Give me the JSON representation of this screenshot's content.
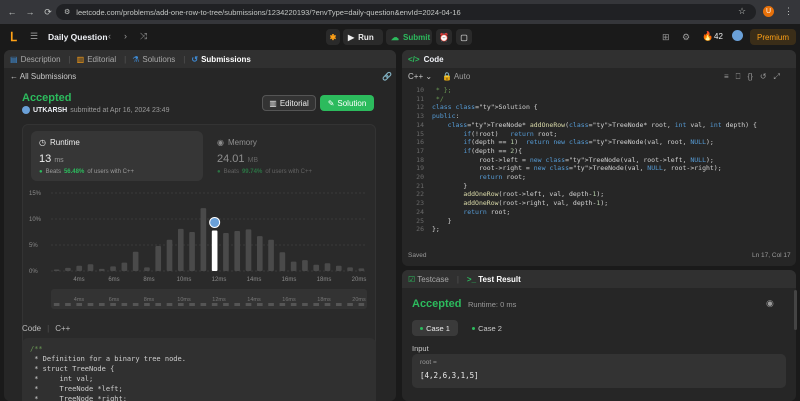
{
  "browser": {
    "url": "leetcode.com/problems/add-one-row-to-tree/submissions/1234220193/?envType=daily-question&envId=2024-04-16",
    "profile_initial": "U"
  },
  "nav": {
    "daily_question": "Daily Question",
    "run": "Run",
    "submit": "Submit",
    "streak": "42",
    "premium": "Premium"
  },
  "left": {
    "tabs": [
      "Description",
      "Editorial",
      "Solutions",
      "Submissions"
    ],
    "all_submissions": "All Submissions",
    "status": "Accepted",
    "author": "UTKARSH",
    "submitted": "submitted at Apr 16, 2024 23:49",
    "editorial_btn": "Editorial",
    "solution_btn": "Solution",
    "runtime": {
      "title": "Runtime",
      "value": "13",
      "unit": "ms",
      "beats_label": "Beats",
      "beats": "56.48%",
      "suffix": "of users with C++"
    },
    "memory": {
      "title": "Memory",
      "value": "24.01",
      "unit": "MB",
      "beats_label": "Beats",
      "beats": "99.74%",
      "suffix": "of users with C++"
    },
    "code_label": "Code",
    "code_lang": "C++",
    "code_lines": [
      "/**",
      " * Definition for a binary tree node.",
      " * struct TreeNode {",
      " *     int val;",
      " *     TreeNode *left;",
      " *     TreeNode *right;"
    ]
  },
  "chart_data": {
    "type": "bar",
    "ylim": [
      0,
      15
    ],
    "ytick_labels": [
      "15%",
      "10%",
      "5%",
      "0%"
    ],
    "xtick_labels": [
      "4ms",
      "6ms",
      "8ms",
      "10ms",
      "12ms",
      "14ms",
      "16ms",
      "18ms",
      "20ms"
    ],
    "values": [
      0.3,
      0.6,
      1.0,
      1.3,
      0.4,
      0.9,
      1.6,
      3.7,
      0.7,
      4.8,
      6.0,
      8.1,
      7.5,
      12.1,
      7.8,
      7.3,
      7.7,
      8.0,
      6.7,
      6.0,
      3.6,
      1.8,
      2.1,
      1.2,
      1.5,
      1.0,
      0.7,
      0.5
    ],
    "highlight_index": 14,
    "highlight_color": "#ffffff",
    "bar_color": "#4a4a4a",
    "grid": true
  },
  "editor": {
    "tab_title": "Code",
    "language": "C++",
    "mode": "Auto",
    "start_line": 10,
    "lines": [
      " * };",
      " */",
      "class Solution {",
      "public:",
      "    TreeNode* addOneRow(TreeNode* root, int val, int depth) {",
      "        if(!root)   return root;",
      "        if(depth == 1)  return new TreeNode(val, root, NULL);",
      "        if(depth == 2){",
      "            root->left = new TreeNode(val, root->left, NULL);",
      "            root->right = new TreeNode(val, NULL, root->right);",
      "            return root;",
      "        }",
      "        addOneRow(root->left, val, depth-1);",
      "        addOneRow(root->right, val, depth-1);",
      "        return root;",
      "    }",
      "};"
    ],
    "saved": "Saved",
    "cursor": "Ln 17, Col 17"
  },
  "testpanel": {
    "tab_testcase": "Testcase",
    "tab_result": "Test Result",
    "status": "Accepted",
    "runtime": "Runtime: 0 ms",
    "case1": "Case 1",
    "case2": "Case 2",
    "input_label": "Input",
    "input_name": "root =",
    "input_value": "[4,2,6,3,1,5]"
  }
}
